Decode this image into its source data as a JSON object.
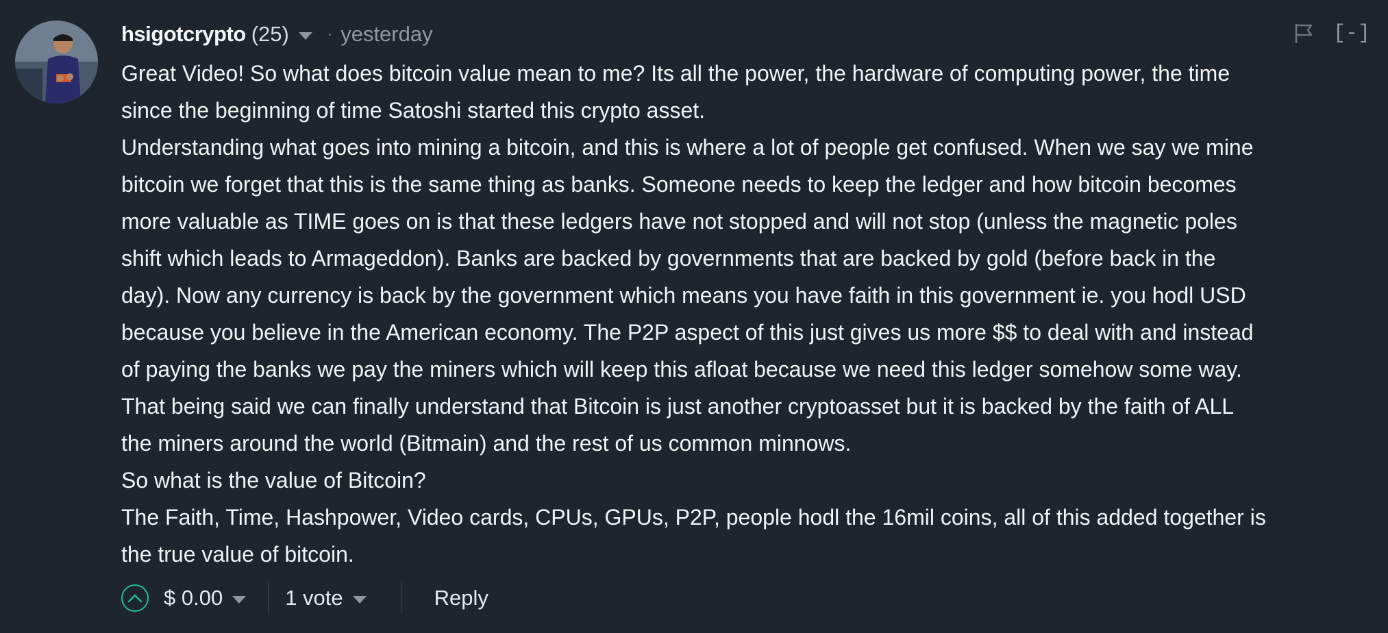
{
  "comment": {
    "author": "hsigotcrypto",
    "reputation": "(25)",
    "separator_dot": "·",
    "timestamp": "yesterday",
    "collapse_label": "[-]",
    "body_lines": [
      "Great Video! So what does bitcoin value mean to me? Its all the power, the hardware of computing power, the time",
      "since the beginning of time Satoshi started this crypto asset.",
      "Understanding what goes into mining a bitcoin, and this is where a lot of people get confused. When we say we mine",
      "bitcoin we forget that this is the same thing as banks. Someone needs to keep the ledger and how bitcoin becomes",
      "more valuable as TIME goes on is that these ledgers have not stopped and will not stop (unless the magnetic poles",
      "shift which leads to Armageddon). Banks are backed by governments that are backed by gold (before back in the",
      "day). Now any currency is back by the government which means you have faith in this government ie. you hodl USD",
      "because you believe in the American economy. The P2P aspect of this just gives us more $$ to deal with and instead",
      "of paying the banks we pay the miners which will keep this afloat because we need this ledger somehow some way.",
      "That being said we can finally understand that Bitcoin is just another cryptoasset but it is backed by the faith of ALL",
      "the miners around the world (Bitmain) and the rest of us common minnows.",
      "So what is the value of Bitcoin?",
      "The Faith, Time, Hashpower, Video cards, CPUs, GPUs, P2P, people hodl the 16mil coins, all of this added together is",
      "the true value of bitcoin."
    ],
    "footer": {
      "payout": "$ 0.00",
      "votes": "1 vote",
      "reply_label": "Reply"
    },
    "icons": {
      "upvote": "chevron-up-circle-icon",
      "flag": "flag-icon",
      "dropdown": "caret-down-icon"
    },
    "colors": {
      "background": "#1e252c",
      "accent": "#1fbf8f",
      "muted": "#8d98a3"
    }
  }
}
